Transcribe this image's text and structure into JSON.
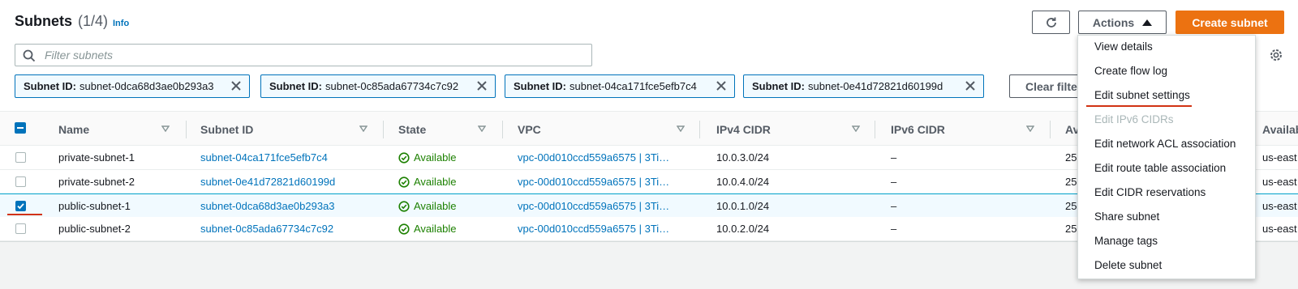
{
  "header": {
    "title": "Subnets",
    "count": "(1/4)",
    "info_label": "Info",
    "actions_label": "Actions",
    "create_label": "Create subnet"
  },
  "search": {
    "placeholder": "Filter subnets"
  },
  "filters": {
    "tokens": [
      {
        "key": "Subnet ID:",
        "value": "subnet-0dca68d3ae0b293a3"
      },
      {
        "key": "Subnet ID:",
        "value": "subnet-0c85ada67734c7c92"
      },
      {
        "key": "Subnet ID:",
        "value": "subnet-04ca171fce5efb7c4"
      },
      {
        "key": "Subnet ID:",
        "value": "subnet-0e41d72821d60199d"
      }
    ],
    "clear_label": "Clear filte"
  },
  "table": {
    "columns": [
      "Name",
      "Subnet ID",
      "State",
      "VPC",
      "IPv4 CIDR",
      "IPv6 CIDR",
      "Av",
      "Availab"
    ],
    "rows": [
      {
        "name": "private-subnet-1",
        "subnet_id": "subnet-04ca171fce5efb7c4",
        "state": "Available",
        "vpc": "vpc-00d010ccd559a6575 | 3Ti…",
        "ipv4": "10.0.3.0/24",
        "ipv6": "–",
        "av": "25",
        "az": "us-east",
        "checked": false
      },
      {
        "name": "private-subnet-2",
        "subnet_id": "subnet-0e41d72821d60199d",
        "state": "Available",
        "vpc": "vpc-00d010ccd559a6575 | 3Ti…",
        "ipv4": "10.0.4.0/24",
        "ipv6": "–",
        "av": "25",
        "az": "us-east",
        "checked": false
      },
      {
        "name": "public-subnet-1",
        "subnet_id": "subnet-0dca68d3ae0b293a3",
        "state": "Available",
        "vpc": "vpc-00d010ccd559a6575 | 3Ti…",
        "ipv4": "10.0.1.0/24",
        "ipv6": "–",
        "av": "25",
        "az": "us-east",
        "checked": true
      },
      {
        "name": "public-subnet-2",
        "subnet_id": "subnet-0c85ada67734c7c92",
        "state": "Available",
        "vpc": "vpc-00d010ccd559a6575 | 3Ti…",
        "ipv4": "10.0.2.0/24",
        "ipv6": "–",
        "av": "25",
        "az": "us-east",
        "checked": false
      }
    ]
  },
  "actions_menu": {
    "items": [
      {
        "label": "View details",
        "disabled": false
      },
      {
        "label": "Create flow log",
        "disabled": false
      },
      {
        "label": "Edit subnet settings",
        "disabled": false
      },
      {
        "label": "Edit IPv6 CIDRs",
        "disabled": true
      },
      {
        "label": "Edit network ACL association",
        "disabled": false
      },
      {
        "label": "Edit route table association",
        "disabled": false
      },
      {
        "label": "Edit CIDR reservations",
        "disabled": false
      },
      {
        "label": "Share subnet",
        "disabled": false
      },
      {
        "label": "Manage tags",
        "disabled": false
      },
      {
        "label": "Delete subnet",
        "disabled": false
      }
    ]
  },
  "colors": {
    "link": "#0073bb",
    "primary_button": "#ec7211",
    "success": "#1d8102",
    "annotation_red": "#d13212"
  },
  "icons": [
    "search-icon",
    "refresh-icon",
    "caret-up-icon",
    "settings-gear-icon",
    "close-icon",
    "sort-icon",
    "status-success-icon",
    "checkbox-icon"
  ]
}
